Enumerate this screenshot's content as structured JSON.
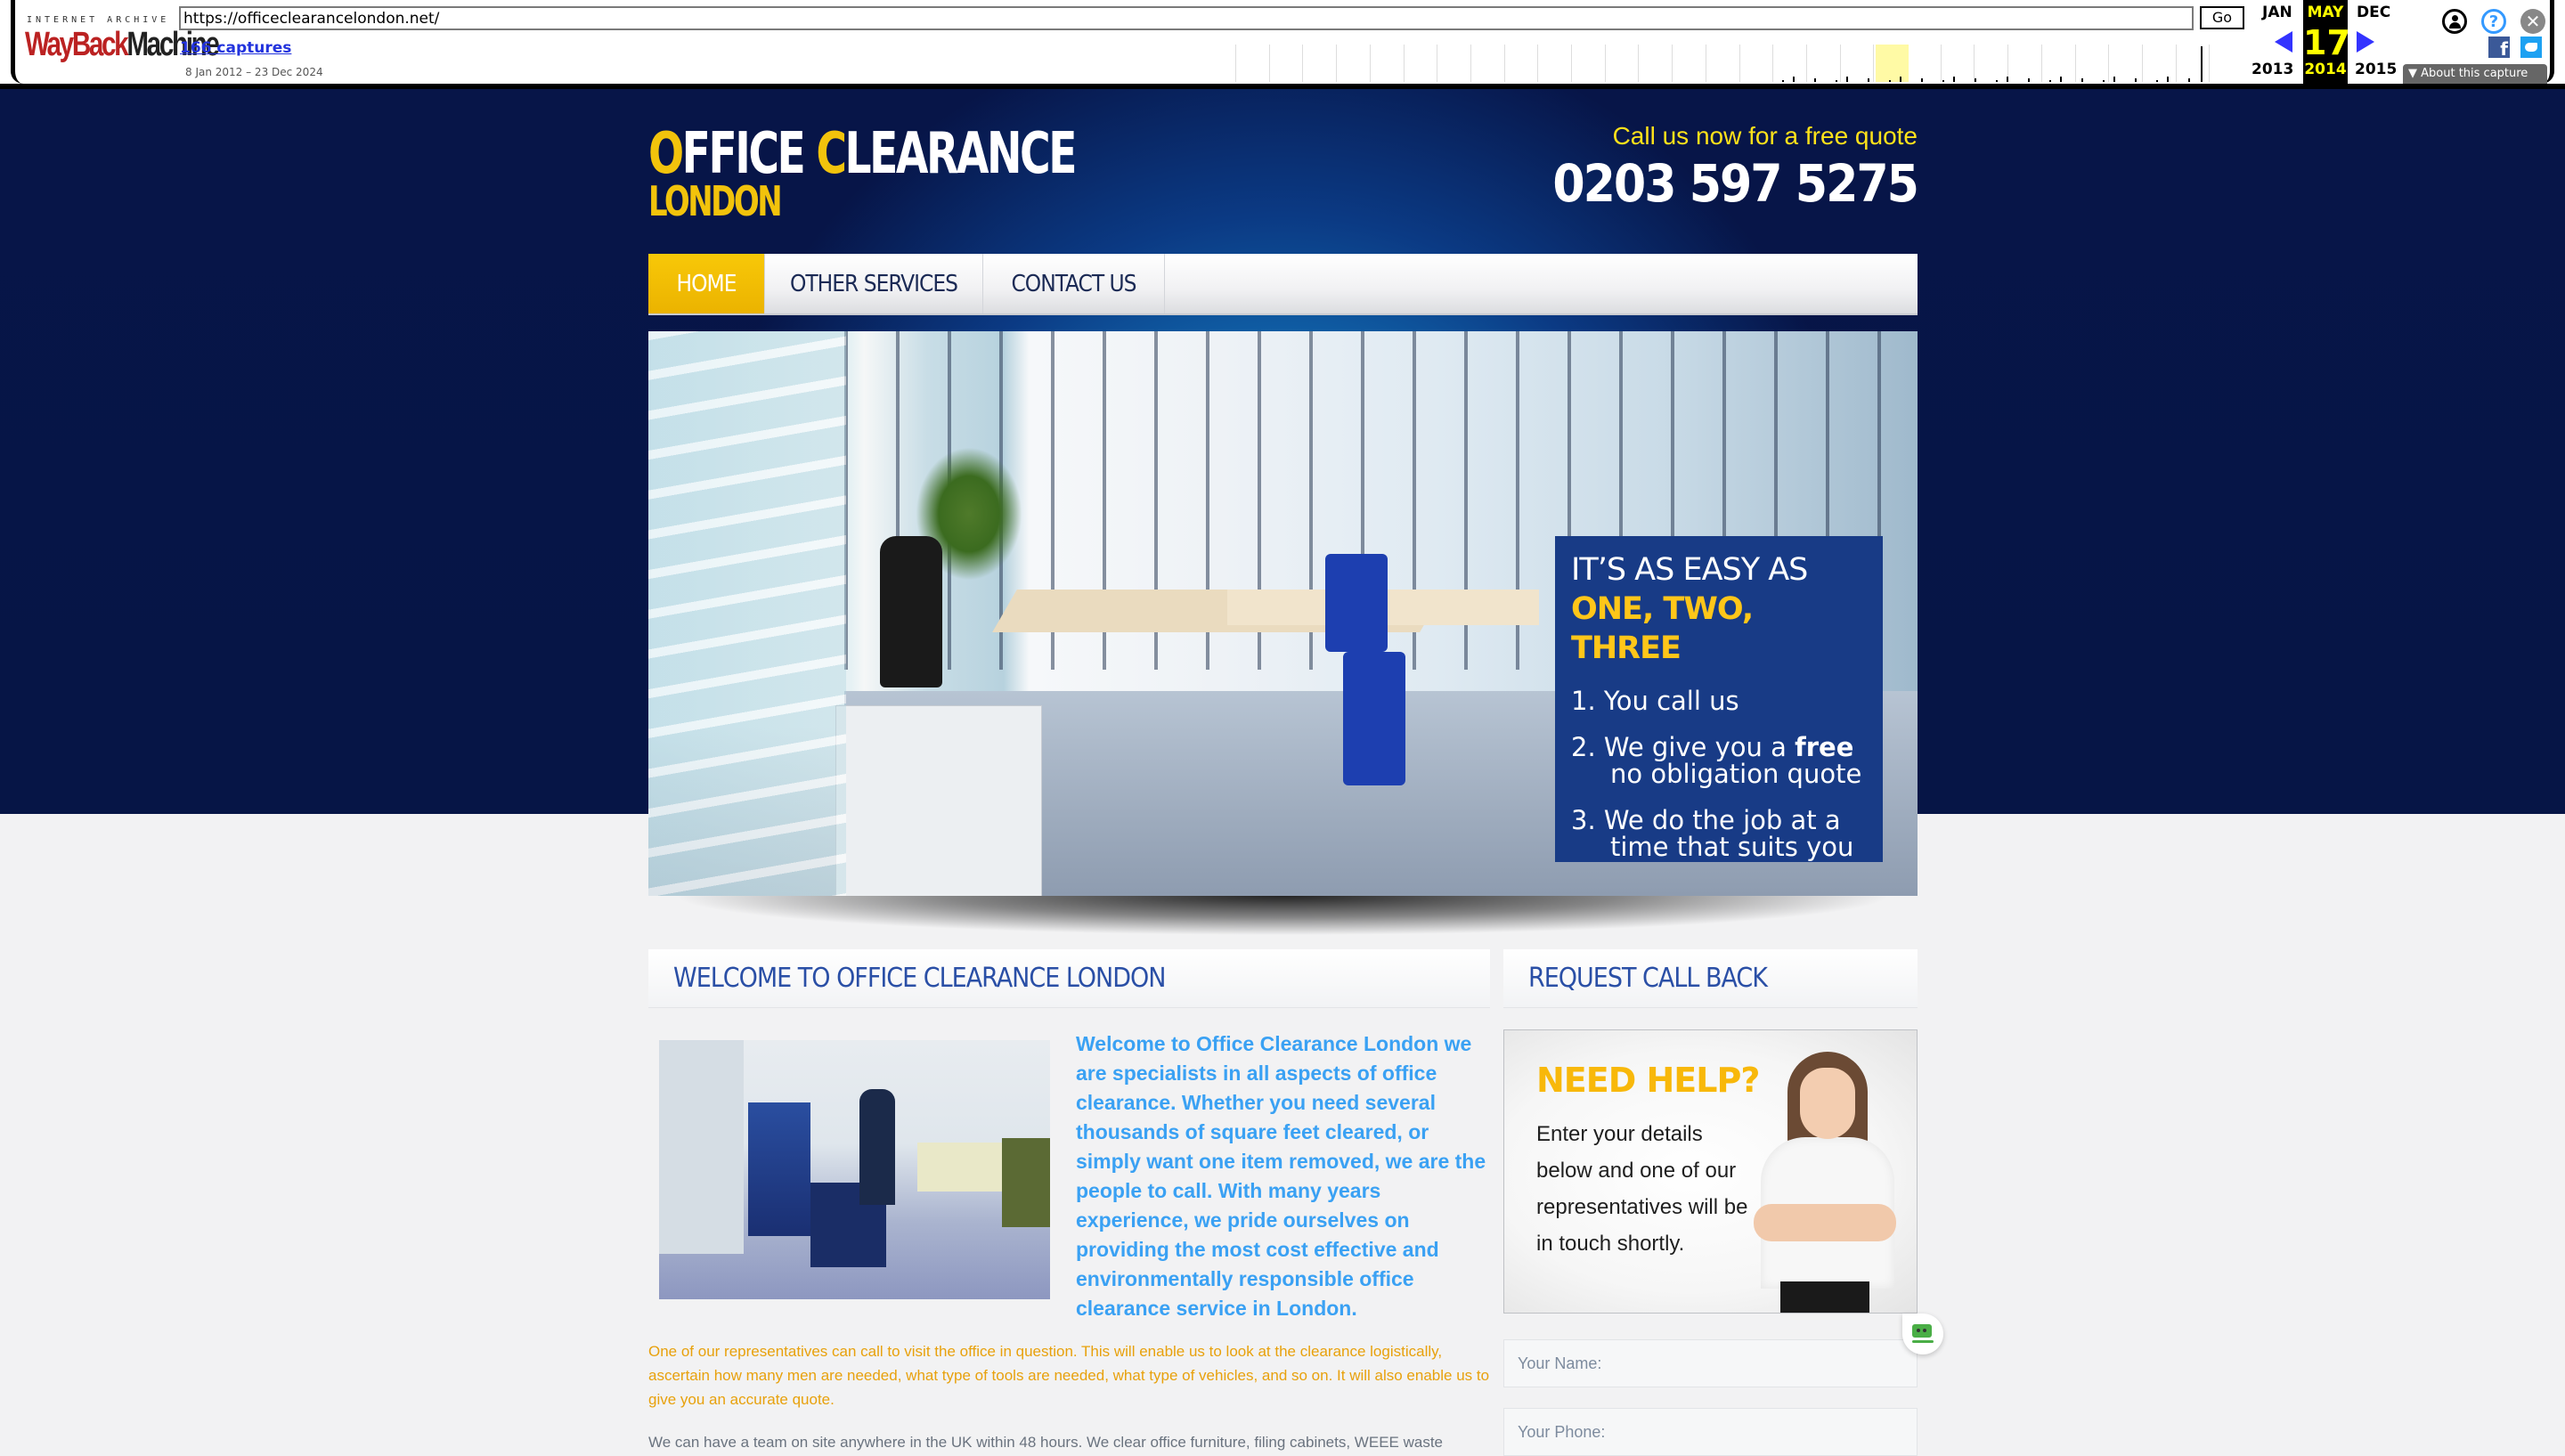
{
  "wayback": {
    "ia_label": "INTERNET ARCHIVE",
    "logo_red": "WayBack",
    "logo_black": "Machine",
    "url": "https://officeclearancelondon.net/",
    "go_label": "Go",
    "captures": "166 captures",
    "date_range": "8 Jan 2012 – 23 Dec 2024",
    "prev_month": "JAN",
    "prev_year": "2013",
    "current_month": "MAY",
    "current_day": "17",
    "current_year": "2014",
    "next_month": "DEC",
    "next_year": "2015",
    "about_label": "▼ About this capture",
    "icons": [
      "user-icon",
      "help-icon",
      "close-icon",
      "facebook-icon",
      "twitter-icon"
    ]
  },
  "header": {
    "logo_line1_first": "O",
    "logo_line1_a": "FFICE ",
    "logo_line1_c": "C",
    "logo_line1_b": "LEARANCE",
    "logo_line2": "LONDON",
    "call_now": "Call us now for a free quote",
    "phone": "0203 597 5275"
  },
  "nav": {
    "items": [
      {
        "label": "HOME",
        "active": true
      },
      {
        "label": "OTHER SERVICES",
        "active": false
      },
      {
        "label": "CONTACT US",
        "active": false
      }
    ]
  },
  "hero": {
    "line1": "IT’S AS EASY AS",
    "line2": "ONE, TWO, THREE",
    "steps": [
      {
        "pre": "1. You call us",
        "bold": "",
        "post": ""
      },
      {
        "pre": "2. We give you a ",
        "bold": "free",
        "post": " no obligation quote"
      },
      {
        "pre": "3. We do the job at a time that suits you",
        "bold": "",
        "post": ""
      }
    ]
  },
  "welcome": {
    "heading": "WELCOME TO OFFICE CLEARANCE LONDON",
    "lead": "Welcome to Office Clearance London we are specialists in all aspects of office clearance. Whether you need several thousands of square feet cleared, or simply want one item removed, we are the people to call. With many years experience, we pride ourselves on providing the most cost effective and environmentally responsible office clearance service in London.",
    "para1": "One of our representatives can call to visit the office in question. This will enable us to look at the clearance logistically, ascertain how many men are needed, what type of tools are needed, what type of vehicles, and so on. It will also enable us to give you an accurate quote.",
    "para2": "We can have a team on site anywhere in the UK within 48 hours. We clear office furniture, filing cabinets, WEEE waste"
  },
  "callback": {
    "heading": "REQUEST CALL BACK",
    "need_help": "NEED HELP?",
    "need_help_text": "Enter your details below and one of our representatives will be in touch shortly.",
    "name_placeholder": "Your Name:",
    "phone_placeholder": "Your Phone:"
  },
  "colors": {
    "accent_yellow": "#f2c30c",
    "heading_blue": "#2a4fa6",
    "lead_blue": "#3aa1f3",
    "para_orange": "#e8a10c",
    "band_navy": "#061546"
  }
}
